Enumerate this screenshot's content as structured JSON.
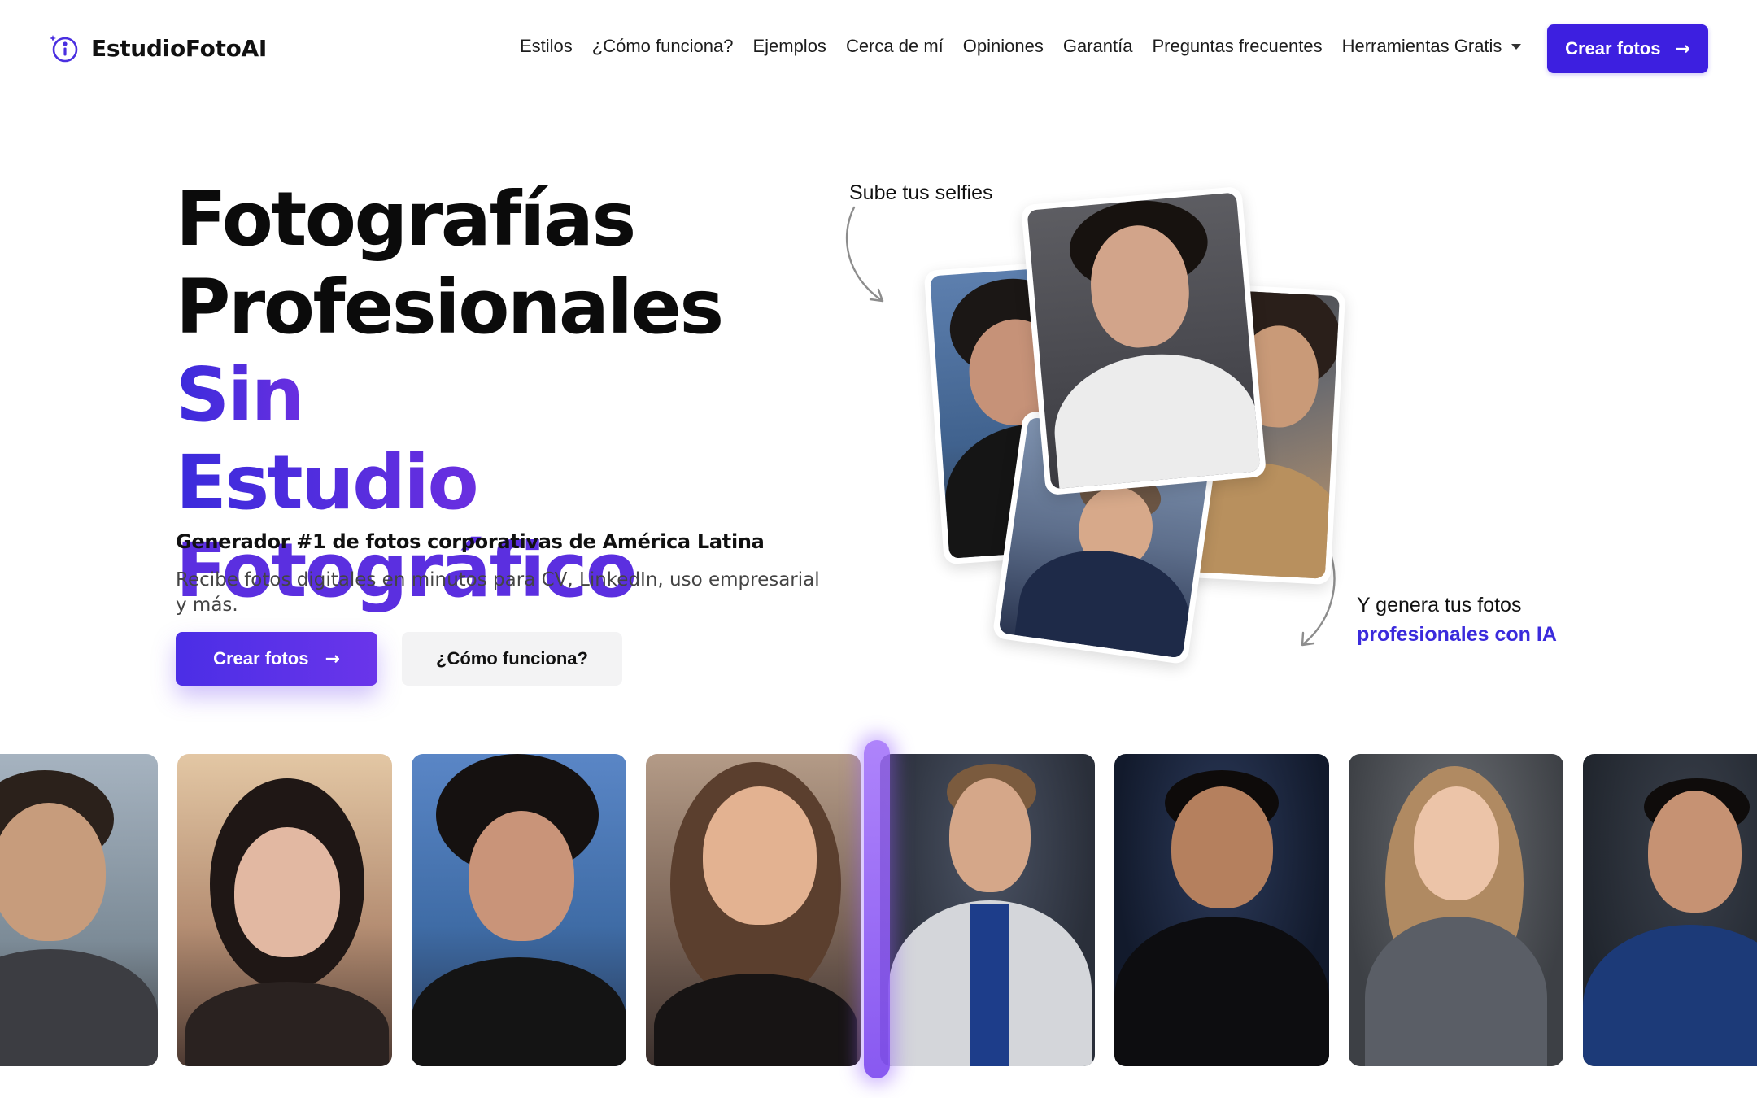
{
  "brand": {
    "name": "EstudioFotoAI",
    "accent_color": "#3d1fe0",
    "icon": "sparkle-circle-logo-icon"
  },
  "nav": {
    "items": [
      "Estilos",
      "¿Cómo funciona?",
      "Ejemplos",
      "Cerca de mí",
      "Opiniones",
      "Garantía",
      "Preguntas frecuentes"
    ],
    "tools_dropdown": "Herramientas Gratis",
    "cta": "Crear fotos"
  },
  "hero": {
    "title_line1": "Fotografías",
    "title_line2a": "Profesionales",
    "title_line2b": "Sin",
    "title_line3": "Estudio",
    "title_line4": "Fotográfico",
    "subtitle": "Generador #1 de fotos corporativas de América Latina",
    "description": "Recibe fotos digitales en minutos para CV, LinkedIn, uso empresarial y más.",
    "primary_button": "Crear fotos",
    "secondary_button": "¿Cómo funciona?",
    "arrow_glyph": "→"
  },
  "collage": {
    "upload_label": "Sube tus selfies",
    "generate_label_line1": "Y genera tus fotos",
    "generate_label_line2": "profesionales con IA"
  },
  "examples_strip": {
    "tiles": [
      {
        "kind": "selfie",
        "bg": "#8c9aa6"
      },
      {
        "kind": "selfie",
        "bg": "#c9a98a"
      },
      {
        "kind": "selfie",
        "bg": "#4b6ea8"
      },
      {
        "kind": "selfie",
        "bg": "#7a6a5e"
      },
      {
        "kind": "professional",
        "bg": "#3a4150"
      },
      {
        "kind": "professional",
        "bg": "#1c2740"
      },
      {
        "kind": "professional",
        "bg": "#4a4d52"
      },
      {
        "kind": "professional",
        "bg": "#2b3038"
      }
    ]
  }
}
